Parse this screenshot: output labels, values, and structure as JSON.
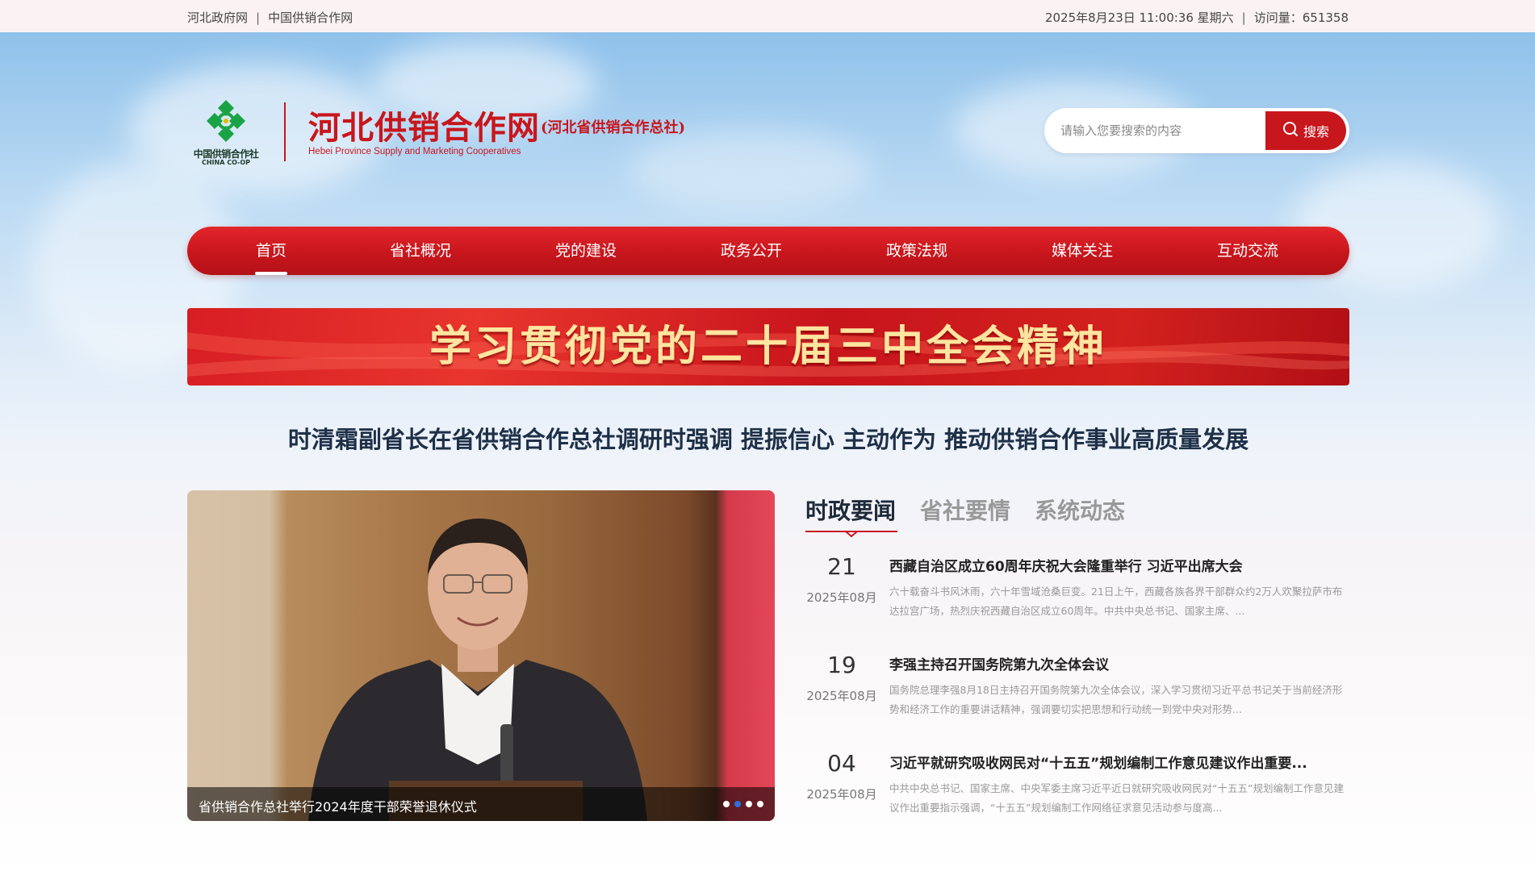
{
  "topbar": {
    "links": [
      "河北政府网",
      "中国供销合作网"
    ],
    "separator": "|",
    "datetime": "2025年8月23日 11:00:36 星期六",
    "visits_label": "访问量：",
    "visits_count": "651358"
  },
  "logo": {
    "org_cn": "中国供销合作社",
    "org_en": "CHINA CO-OP",
    "title": "河北供销合作网",
    "subtitle": "(河北省供销合作总社)",
    "title_en": "Hebei Province Supply and Marketing Cooperatives"
  },
  "search": {
    "placeholder": "请输入您要搜索的内容",
    "button_label": "搜索",
    "icon": "search-icon"
  },
  "nav": {
    "active_index": 0,
    "items": [
      "首页",
      "省社概况",
      "党的建设",
      "政务公开",
      "政策法规",
      "媒体关注",
      "互动交流"
    ]
  },
  "banner": {
    "text": "学习贯彻党的二十届三中全会精神"
  },
  "headline": "时清霜副省长在省供销合作总社调研时强调 提振信心 主动作为 推动供销合作事业高质量发展",
  "slider": {
    "caption": "省供销合作总社举行2024年度干部荣誉退休仪式",
    "dots": 4,
    "active_dot": 1
  },
  "news": {
    "tabs": [
      "时政要闻",
      "省社要情",
      "系统动态"
    ],
    "active_tab": 0,
    "items": [
      {
        "day": "21",
        "month": "2025年08月",
        "title": "西藏自治区成立60周年庆祝大会隆重举行 习近平出席大会",
        "summary": "六十载奋斗书风沐雨，六十年雪域沧桑巨变。21日上午，西藏各族各界干部群众约2万人欢聚拉萨市布达拉宫广场，热烈庆祝西藏自治区成立60周年。中共中央总书记、国家主席、..."
      },
      {
        "day": "19",
        "month": "2025年08月",
        "title": "李强主持召开国务院第九次全体会议",
        "summary": "国务院总理李强8月18日主持召开国务院第九次全体会议，深入学习贯彻习近平总书记关于当前经济形势和经济工作的重要讲话精神，强调要切实把思想和行动统一到党中央对形势..."
      },
      {
        "day": "04",
        "month": "2025年08月",
        "title": "习近平就研究吸收网民对“十五五”规划编制工作意见建议作出重要...",
        "summary": "中共中央总书记、国家主席、中央军委主席习近平近日就研究吸收网民对“十五五”规划编制工作意见建议作出重要指示强调，“十五五”规划编制工作网络征求意见活动参与度高..."
      }
    ]
  },
  "colors": {
    "brand_red": "#c8161d",
    "banner_text": "#ffe5a0",
    "headline": "#1e3048",
    "dot_active": "#2f6de0"
  }
}
